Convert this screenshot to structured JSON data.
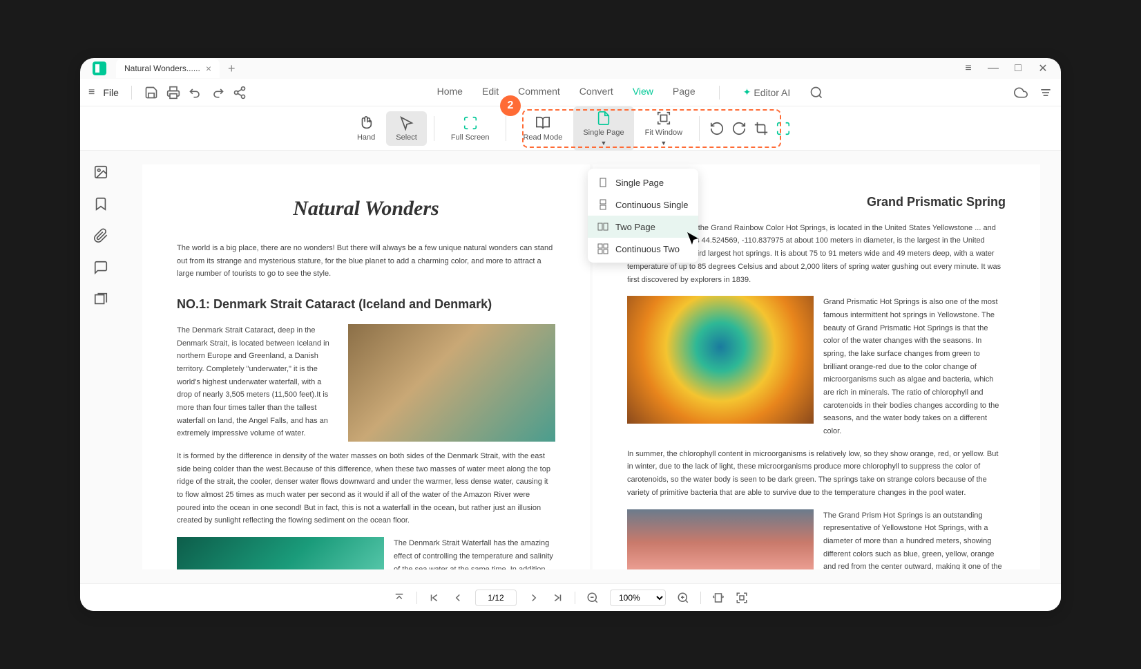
{
  "tab": {
    "title": "Natural Wonders......"
  },
  "annotation": {
    "badge": "2"
  },
  "menubar": {
    "file": "File",
    "items": [
      "Home",
      "Edit",
      "Comment",
      "Convert",
      "View",
      "Page"
    ],
    "activeIndex": 4,
    "editorAI": "Editor AI"
  },
  "toolbar": {
    "hand": "Hand",
    "select": "Select",
    "fullscreen": "Full Screen",
    "readmode": "Read Mode",
    "singlepage": "Single Page",
    "fitwindow": "Fit Window"
  },
  "dropdown": {
    "items": [
      "Single Page",
      "Continuous Single",
      "Two Page",
      "Continuous Two"
    ],
    "hoverIndex": 2
  },
  "bottombar": {
    "page": "1/12",
    "zoom": "100%"
  },
  "doc": {
    "page1": {
      "title": "Natural Wonders",
      "intro": "The world is a big place, there are no wonders! But there will always be a few unique natural wonders can stand out from its strange and mysterious stature, for the blue planet to add a charming color, and more to attract a large number of tourists to go to see the style.",
      "h2": "NO.1: Denmark Strait Cataract (Iceland and Denmark)",
      "p1": "The Denmark Strait Cataract, deep in the Denmark Strait, is located between Iceland in northern Europe and Greenland, a Danish territory. Completely \"underwater,\" it is the world's highest underwater waterfall, with a drop of nearly 3,505 meters (11,500 feet).It is more than four times taller than the tallest waterfall on land, the Angel Falls, and has an extremely impressive volume of water.",
      "p2": "It is formed by the difference in density of the water masses on both sides of the Denmark Strait, with the east side being colder than the west.Because of this difference, when these two masses of water meet along the top ridge of the strait, the cooler, denser water flows downward and under the warmer, less dense water, causing it to flow almost 25 times as much water per second as it would if all of the water of the Amazon River were poured into the ocean in one second! But in fact, this is not a waterfall in the ocean, but rather just an illusion created by sunlight reflecting the flowing sediment on the ocean floor.",
      "p3": "The Denmark Strait Waterfall has the amazing effect of controlling the temperature and salinity of the sea water at the same time. In addition, there is not only this underwater waterfall in the"
    },
    "page2": {
      "h2": "Grand Prismatic Spring",
      "p1": "...ing, also known as the Grand Rainbow Color Hot Springs, is located in the United States Yellowstone ... and longitude coordinates 44.524569, -110.837975 at about 100 meters in diameter, is the largest in the United States, the world's third largest hot springs. It is about 75 to 91 meters wide and 49 meters deep, with a water temperature of up to 85 degrees Celsius and about 2,000 liters of spring water gushing out every minute. It was first discovered by explorers in 1839.",
      "p2": "Grand Prismatic Hot Springs is also one of the most famous intermittent hot springs in Yellowstone. The beauty of Grand Prismatic Hot Springs is that the color of the water changes with the seasons. In spring, the lake surface changes from green to brilliant orange-red due to the color change of microorganisms such as algae and bacteria, which are rich in minerals. The ratio of chlorophyll and carotenoids in their bodies changes according to the seasons, and the water body takes on a different color.",
      "p3": " In summer, the chlorophyll content in microorganisms is relatively low, so they show orange, red, or yellow. But in winter, due to the lack of light, these microorganisms produce more chlorophyll to suppress the color of carotenoids, so the water body is seen to be dark green. The springs take on strange colors because of the variety of primitive bacteria that are able to survive due to the temperature changes in the pool water.",
      "p4": "The Grand Prism Hot Springs is an outstanding representative of Yellowstone Hot Springs, with a diameter of more than a hundred meters, showing different colors such as blue, green, yellow, orange and red from the center outward, making it one of the largest and most colorful landscapes."
    }
  }
}
